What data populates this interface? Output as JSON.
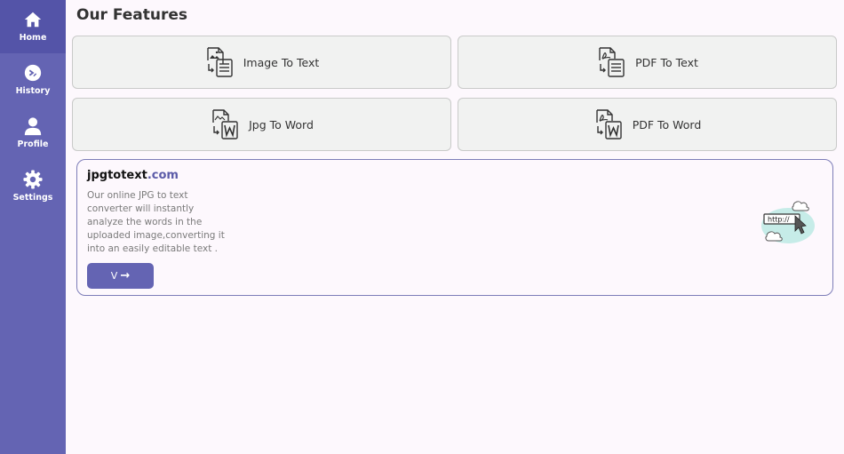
{
  "sidebar": {
    "items": [
      {
        "label": "Home",
        "icon": "home-icon",
        "active": true
      },
      {
        "label": "History",
        "icon": "history-icon",
        "active": false
      },
      {
        "label": "Profile",
        "icon": "profile-icon",
        "active": false
      },
      {
        "label": "Settings",
        "icon": "settings-icon",
        "active": false
      }
    ]
  },
  "main": {
    "title": "Our Features",
    "features": [
      {
        "label": "Image To Text",
        "icon": "image-to-text-icon"
      },
      {
        "label": "PDF To Text",
        "icon": "pdf-to-text-icon"
      },
      {
        "label": "Jpg To Word",
        "icon": "jpg-to-word-icon"
      },
      {
        "label": "PDF To Word",
        "icon": "pdf-to-word-icon"
      }
    ]
  },
  "promo": {
    "brand_name": "jpgtotext",
    "brand_tld": ".com",
    "description": "Our online JPG to text converter will instantly analyze the words in the uploaded image,converting it into an easily editable text .",
    "button_label": "V",
    "button_icon": "arrow-right-icon",
    "illustration_text": "http://",
    "illustration_icon": "web-cursor-illustration"
  },
  "colors": {
    "sidebar": "#6464b3",
    "accent": "#5b5ba8",
    "card_bg": "#f1f2f1",
    "page_bg": "#fdf8fd"
  }
}
